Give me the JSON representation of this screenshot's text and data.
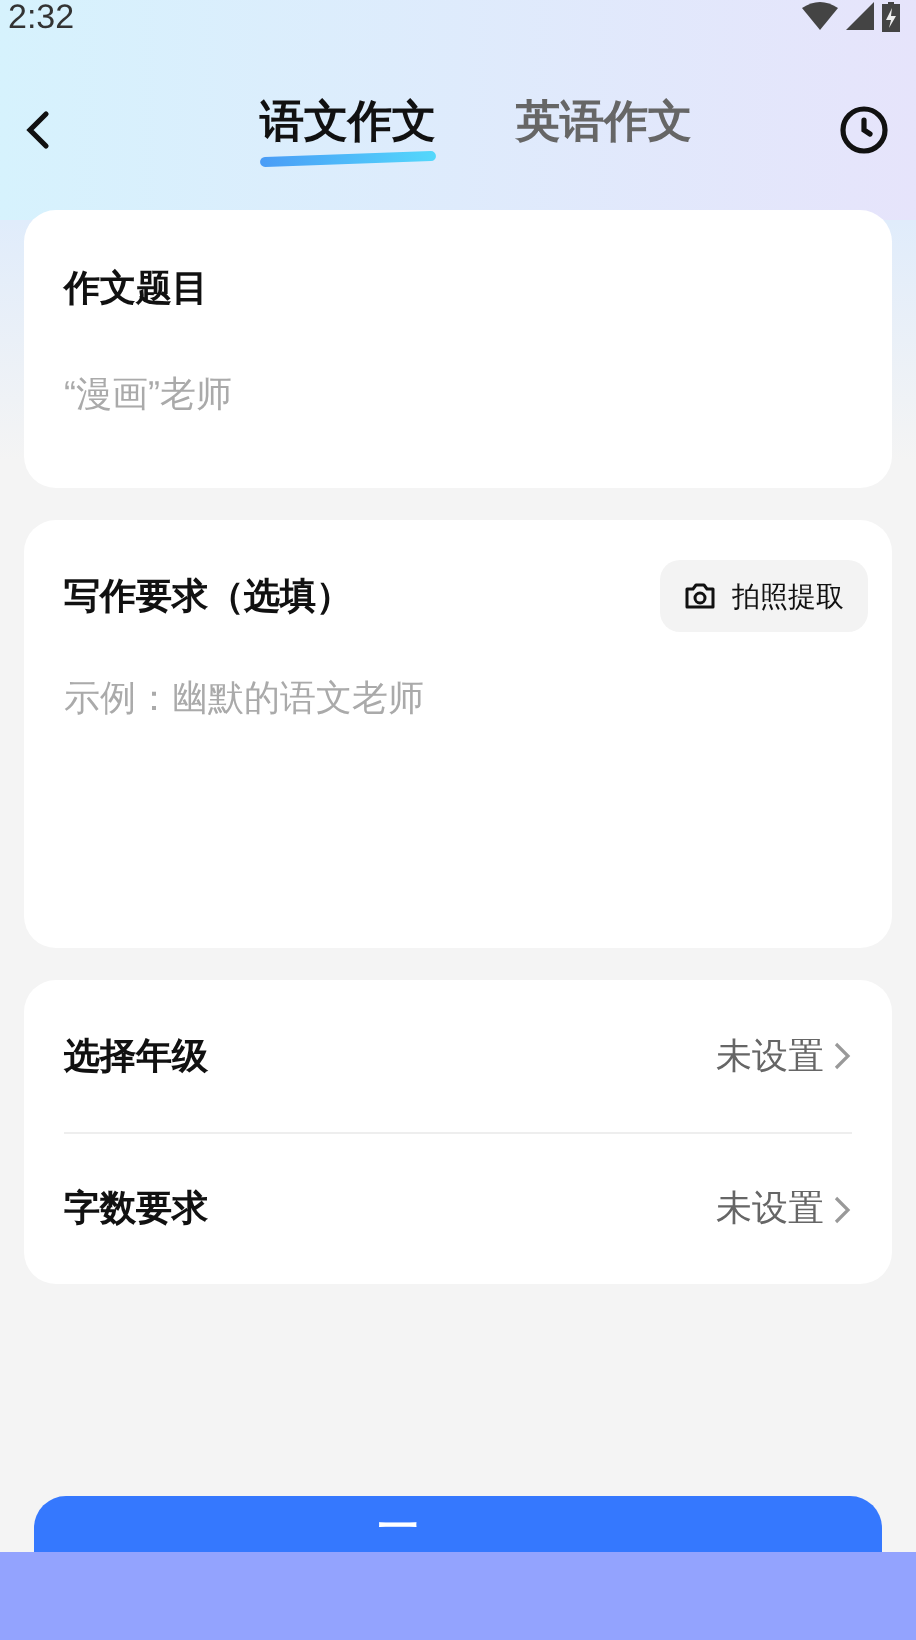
{
  "status_bar": {
    "time": "2:32"
  },
  "tabs": [
    {
      "label": "语文作文",
      "selected": true
    },
    {
      "label": "英语作文",
      "selected": false
    }
  ],
  "topic_card": {
    "title": "作文题目",
    "placeholder": "“漫画”老师"
  },
  "requirements_card": {
    "title": "写作要求（选填）",
    "photo_button": "拍照提取",
    "placeholder": "示例：幽默的语文老师"
  },
  "settings": [
    {
      "label": "选择年级",
      "value": "未设置"
    },
    {
      "label": "字数要求",
      "value": "未设置"
    }
  ],
  "submit_button": "一"
}
